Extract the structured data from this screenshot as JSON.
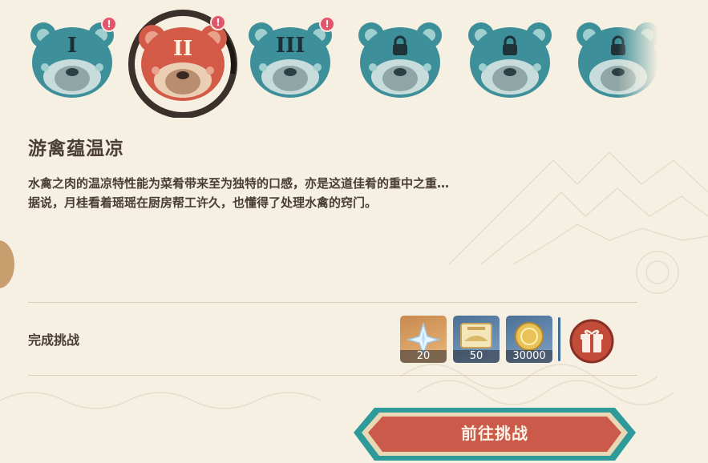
{
  "stages": [
    {
      "numeral": "I",
      "status": "new",
      "badge": "!"
    },
    {
      "numeral": "II",
      "status": "selected",
      "badge": "!"
    },
    {
      "numeral": "III",
      "status": "new",
      "badge": "!"
    },
    {
      "numeral": "",
      "status": "locked",
      "icon": "lock-icon"
    },
    {
      "numeral": "",
      "status": "locked",
      "icon": "lock-icon"
    },
    {
      "numeral": "",
      "status": "locked",
      "icon": "lock-icon"
    }
  ],
  "challenge": {
    "title": "游禽蕴温凉",
    "description_lines": [
      "水禽之肉的温凉特性能为菜肴带来至为独特的口感，亦是这道佳肴的重中之重…",
      "据说，月桂看着瑶瑶在厨房帮工许久，也懂得了处理水禽的窍门。"
    ]
  },
  "rewards_section": {
    "label": "完成挑战",
    "items": [
      {
        "icon": "primogem-icon",
        "count": "20"
      },
      {
        "icon": "hero-wit-book-icon",
        "count": "50"
      },
      {
        "icon": "mora-coin-icon",
        "count": "30000"
      }
    ],
    "extra_icon": "gift-icon"
  },
  "go_button": {
    "label": "前往挑战"
  },
  "colors": {
    "background": "#f6f0e2",
    "bear_teal": "#3d8f9a",
    "bear_red": "#d45a48",
    "button_red": "#cc5a4a",
    "badge_red": "#e0566a"
  }
}
